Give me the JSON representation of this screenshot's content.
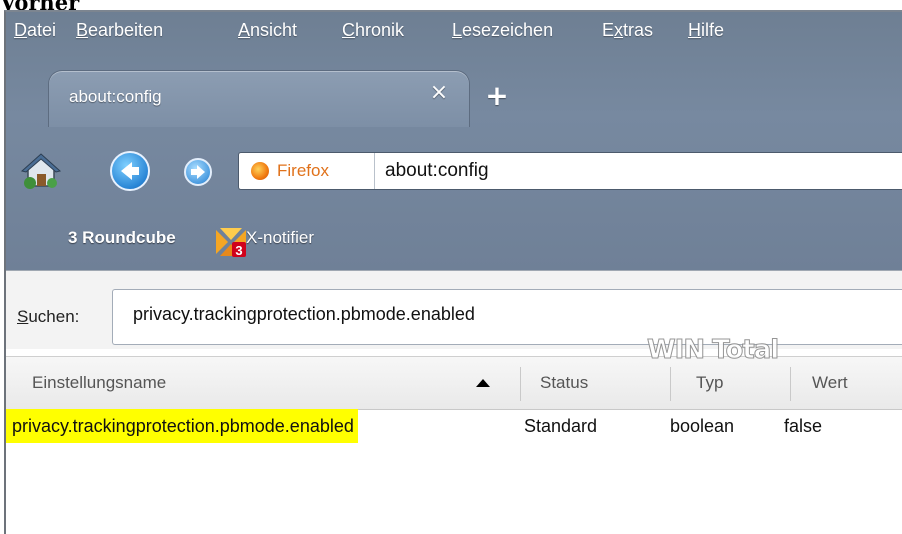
{
  "caption": "Vorher",
  "menubar": {
    "items": [
      {
        "mnemonic": "D",
        "rest": "atei"
      },
      {
        "mnemonic": "B",
        "rest": "earbeiten"
      },
      {
        "mnemonic": "A",
        "rest": "nsicht"
      },
      {
        "mnemonic": "C",
        "rest": "hronik"
      },
      {
        "mnemonic": "L",
        "rest": "esezeichen"
      },
      {
        "pre": "E",
        "mnemonic": "x",
        "rest": "tras"
      },
      {
        "mnemonic": "H",
        "rest": "ilfe"
      }
    ]
  },
  "tabs": {
    "active_title": "about:config",
    "close_glyph": "×",
    "new_tab_glyph": "+"
  },
  "navbar": {
    "identity_label": "Firefox",
    "url": "about:config",
    "icons": [
      "home-icon",
      "back-arrow-icon",
      "forward-arrow-icon",
      "firefox-icon"
    ]
  },
  "bookmarks": {
    "items": [
      "3 Roundcube",
      "X-notifier"
    ],
    "xnotifier_badge": "3"
  },
  "search": {
    "label_mnemonic": "S",
    "label_rest": "uchen:",
    "value": "privacy.trackingprotection.pbmode.enabled"
  },
  "watermark": "WIN Total",
  "table": {
    "headers": [
      "Einstellungsname",
      "Status",
      "Typ",
      "Wert"
    ],
    "sort": "ascending",
    "rows": [
      {
        "name": "privacy.trackingprotection.pbmode.enabled",
        "status": "Standard",
        "type": "boolean",
        "value": "false"
      }
    ]
  },
  "colors": {
    "chrome": "#7789a0",
    "highlight": "#ffff00",
    "firefox_label": "#e0721b"
  }
}
